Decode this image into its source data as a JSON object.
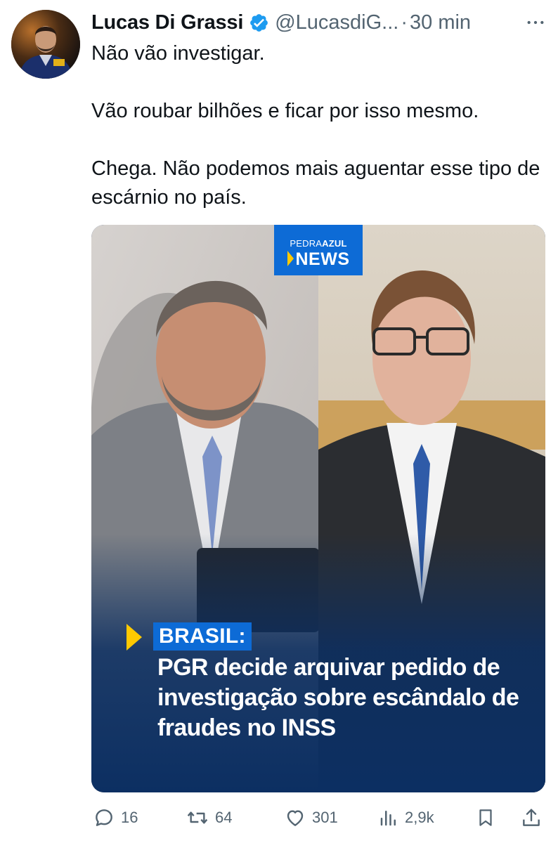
{
  "author": {
    "name": "Lucas Di Grassi",
    "handle": "@LucasdiG...",
    "separator": "·",
    "time": "30 min"
  },
  "tweet": {
    "paragraphs": [
      "Não vão investigar.",
      "Vão roubar bilhões e ficar por isso mesmo.",
      "Chega. Não podemos mais aguentar esse tipo de escárnio no país."
    ]
  },
  "media": {
    "brand_top_regular": "PEDRA",
    "brand_top_bold": "AZUL",
    "brand_main": "NEWS",
    "tag": "BRASIL:",
    "headline": "PGR decide arquivar pedido de investigação sobre escândalo de fraudes no INSS"
  },
  "actions": {
    "replies": "16",
    "reposts": "64",
    "likes": "301",
    "views": "2,9k"
  },
  "colors": {
    "verified": "#1d9bf0",
    "muted": "#536471",
    "brand_blue": "#0d6bd6",
    "accent_yellow": "#ffc900",
    "banner_navy": "#0c2f62"
  },
  "icons": [
    "verified-badge-icon",
    "more-icon",
    "reply-icon",
    "repost-icon",
    "like-icon",
    "views-icon",
    "bookmark-icon",
    "share-icon"
  ]
}
